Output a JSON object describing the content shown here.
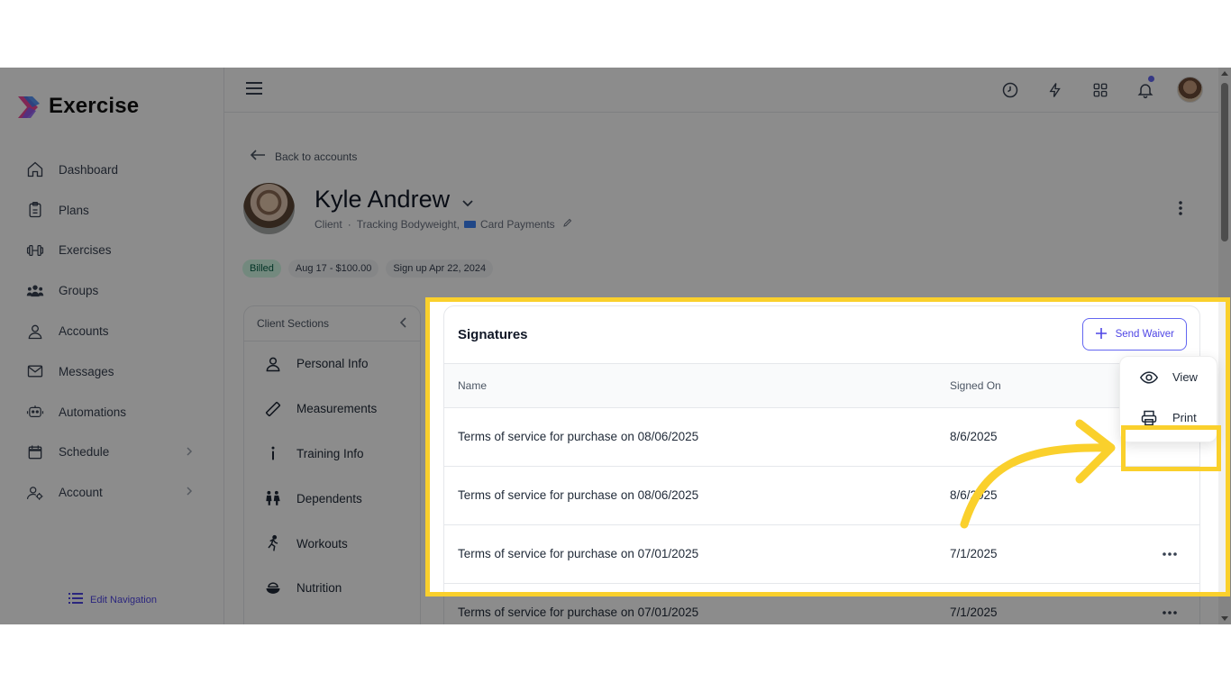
{
  "app": {
    "name": "Exercise"
  },
  "sidebar": {
    "items": [
      {
        "label": "Dashboard",
        "icon": "home-icon"
      },
      {
        "label": "Plans",
        "icon": "clipboard-icon"
      },
      {
        "label": "Exercises",
        "icon": "dumbbell-icon"
      },
      {
        "label": "Groups",
        "icon": "users-icon"
      },
      {
        "label": "Accounts",
        "icon": "user-icon"
      },
      {
        "label": "Messages",
        "icon": "mail-icon"
      },
      {
        "label": "Automations",
        "icon": "robot-icon"
      },
      {
        "label": "Schedule",
        "icon": "calendar-icon"
      },
      {
        "label": "Account",
        "icon": "user-gear-icon"
      }
    ],
    "edit_nav": "Edit Navigation"
  },
  "main": {
    "back_label": "Back to accounts",
    "client": {
      "name": "Kyle Andrew",
      "role": "Client",
      "separator": "·",
      "tracking": "Tracking Bodyweight,",
      "payments": "Card Payments"
    },
    "badges": [
      "Billed",
      "Aug 17 - $100.00",
      "Sign up Apr 22, 2024"
    ],
    "sections": {
      "title": "Client Sections",
      "items": [
        {
          "label": "Personal Info",
          "icon": "user-icon"
        },
        {
          "label": "Measurements",
          "icon": "ruler-icon"
        },
        {
          "label": "Training Info",
          "icon": "info-icon"
        },
        {
          "label": "Dependents",
          "icon": "family-icon"
        },
        {
          "label": "Workouts",
          "icon": "running-icon"
        },
        {
          "label": "Nutrition",
          "icon": "bowl-icon"
        }
      ]
    },
    "signatures": {
      "title": "Signatures",
      "send_button": "Send Waiver",
      "columns": [
        "Name",
        "Signed On"
      ],
      "rows": [
        {
          "name": "Terms of service for purchase on 08/06/2025",
          "signed_on": "8/6/2025"
        },
        {
          "name": "Terms of service for purchase on 08/06/2025",
          "signed_on": "8/6/2025"
        },
        {
          "name": "Terms of service for purchase on 07/01/2025",
          "signed_on": "7/1/2025"
        },
        {
          "name": "Terms of service for purchase on 07/01/2025",
          "signed_on": "7/1/2025"
        }
      ]
    },
    "menu": {
      "view": "View",
      "print": "Print"
    }
  },
  "colors": {
    "accent": "#4f46e5",
    "highlight": "#fad02c",
    "billed_badge": "#d1fae5"
  }
}
